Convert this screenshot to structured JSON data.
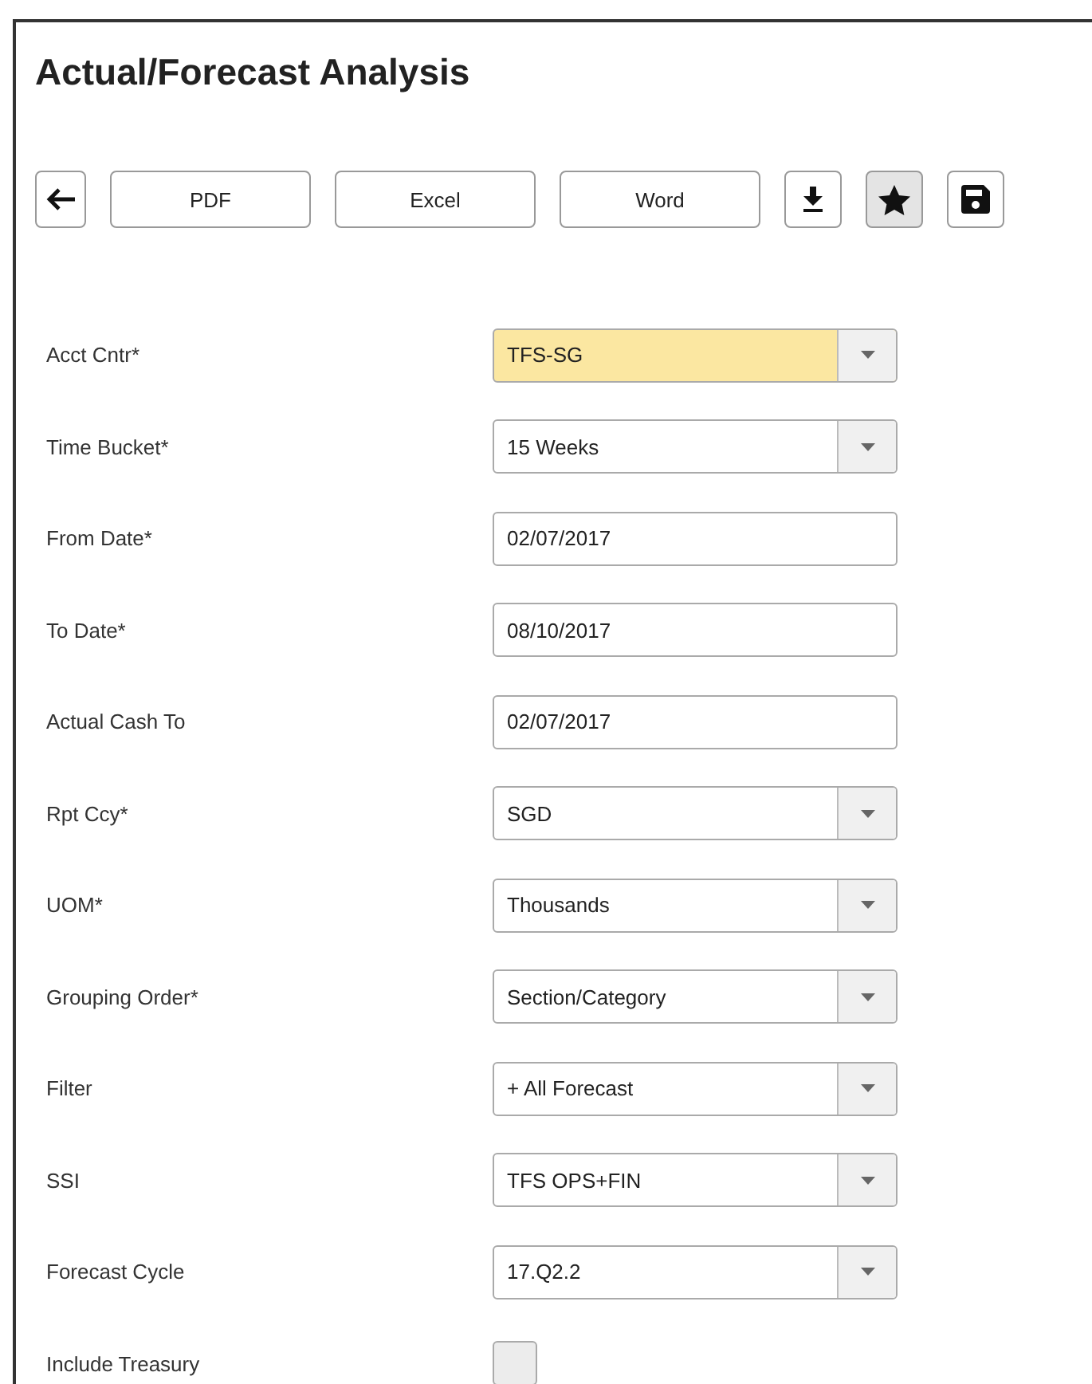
{
  "title": "Actual/Forecast Analysis",
  "toolbar": [
    {
      "kind": "back",
      "active": false
    },
    {
      "kind": "text",
      "label": "PDF",
      "active": false
    },
    {
      "kind": "text",
      "label": "Excel",
      "active": false
    },
    {
      "kind": "text",
      "label": "Word",
      "active": false
    },
    {
      "kind": "download",
      "active": false
    },
    {
      "kind": "star",
      "active": true
    },
    {
      "kind": "save",
      "active": false
    }
  ],
  "fields": [
    {
      "label": "Acct Cntr*",
      "kind": "select",
      "value": "TFS-SG",
      "highlighted": true
    },
    {
      "label": "Time Bucket*",
      "kind": "select",
      "value": "15 Weeks",
      "highlighted": false
    },
    {
      "label": "From Date*",
      "kind": "text",
      "value": "02/07/2017",
      "highlighted": false
    },
    {
      "label": "To Date*",
      "kind": "text",
      "value": "08/10/2017",
      "highlighted": false
    },
    {
      "label": "Actual Cash To",
      "kind": "text",
      "value": "02/07/2017",
      "highlighted": false
    },
    {
      "label": "Rpt Ccy*",
      "kind": "select",
      "value": "SGD",
      "highlighted": false
    },
    {
      "label": "UOM*",
      "kind": "select",
      "value": "Thousands",
      "highlighted": false
    },
    {
      "label": "Grouping Order*",
      "kind": "select",
      "value": "Section/Category",
      "highlighted": false
    },
    {
      "label": "Filter",
      "kind": "select",
      "value": "+ All Forecast",
      "highlighted": false
    },
    {
      "label": "SSI",
      "kind": "select",
      "value": "TFS OPS+FIN",
      "highlighted": false
    },
    {
      "label": "Forecast Cycle",
      "kind": "select",
      "value": "17.Q2.2",
      "highlighted": false
    },
    {
      "label": "Include Treasury",
      "kind": "checkbox",
      "checked": false
    }
  ]
}
